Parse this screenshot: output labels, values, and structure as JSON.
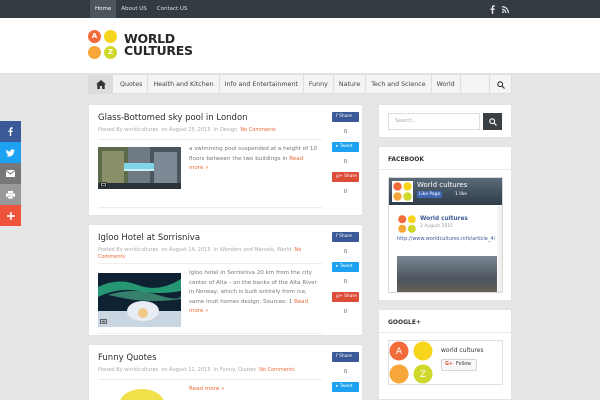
{
  "topbar": {
    "nav": [
      "Home",
      "About US",
      "Contact US"
    ],
    "active_index": 0,
    "social_icons": [
      "facebook-icon",
      "rss-icon"
    ]
  },
  "logo": {
    "letters": [
      "A",
      "",
      "",
      "Z"
    ],
    "text_line1": "WORLD",
    "text_line2": "CULTURES",
    "colors": [
      "#f26b3a",
      "#f7d51d",
      "#f7a63a",
      "#cfd82a"
    ]
  },
  "mainnav": {
    "items": [
      "Quotes",
      "Health and Kitchen",
      "Info and Entertainment",
      "Funny",
      "Nature",
      "Tech and Science",
      "World"
    ]
  },
  "posts": [
    {
      "title": "Glass-Bottomed sky pool in London",
      "meta_prefix": "Posted By",
      "author": "worldcultures",
      "date_prefix": "on",
      "date": "August 25, 2015",
      "cat_prefix": "In",
      "categories": "Design",
      "comments": "No Comments",
      "excerpt": "a swimming pool suspended at a height of 10 floors between the two buildings in",
      "more": "Read more »",
      "share": {
        "facebook": "Share",
        "twitter": "Tweet",
        "google": "Share",
        "counts": [
          "0",
          "0",
          "0"
        ]
      }
    },
    {
      "title": "Igloo Hotel at Sorrisniva",
      "meta_prefix": "Posted By",
      "author": "worldcultures",
      "date_prefix": "on",
      "date": "August 14, 2015",
      "cat_prefix": "In",
      "categories": "Wonders and Marvels, World",
      "comments": "No Comments",
      "excerpt": "Igloo hotel in Sorrisniva 20 km from the city center of Alta – on the banks of the Alta River in Norway, which is built entirely from ice, same Inuit homes design. Sources: 1",
      "more": "Read more »",
      "share": {
        "facebook": "Share",
        "twitter": "Tweet",
        "google": "Share",
        "counts": [
          "0",
          "0",
          "0"
        ]
      }
    },
    {
      "title": "Funny Quotes",
      "meta_prefix": "Posted By",
      "author": "worldcultures",
      "date_prefix": "on",
      "date": "August 11, 2015",
      "cat_prefix": "In",
      "categories": "Funny, Quotes",
      "comments": "No Comments",
      "excerpt": "",
      "more": "Read more »",
      "share": {
        "facebook": "Share",
        "twitter": "Tweet",
        "counts": [
          "0"
        ]
      }
    }
  ],
  "float_share": [
    "facebook-icon",
    "twitter-icon",
    "email-icon",
    "print-icon",
    "plus-icon"
  ],
  "sidebar": {
    "search_placeholder": "Search...",
    "facebook": {
      "title": "FACEBOOK",
      "page_name": "World cultures",
      "like_button": "Like Page",
      "like_count": "1 like",
      "post_name": "World cultures",
      "post_date": "2 August 2015",
      "post_link": "http://www.worldcultures.info/article_4/"
    },
    "google": {
      "title": "GOOGLE+",
      "name": "world cultures",
      "follow": "Follow",
      "g_letter": "G+"
    }
  },
  "colors": {
    "facebook": "#3b5998",
    "twitter": "#1da1f2",
    "email": "#777777",
    "print": "#999999",
    "plus": "#f0533c",
    "google": "#dd4b39",
    "accent": "#e86c3a"
  }
}
